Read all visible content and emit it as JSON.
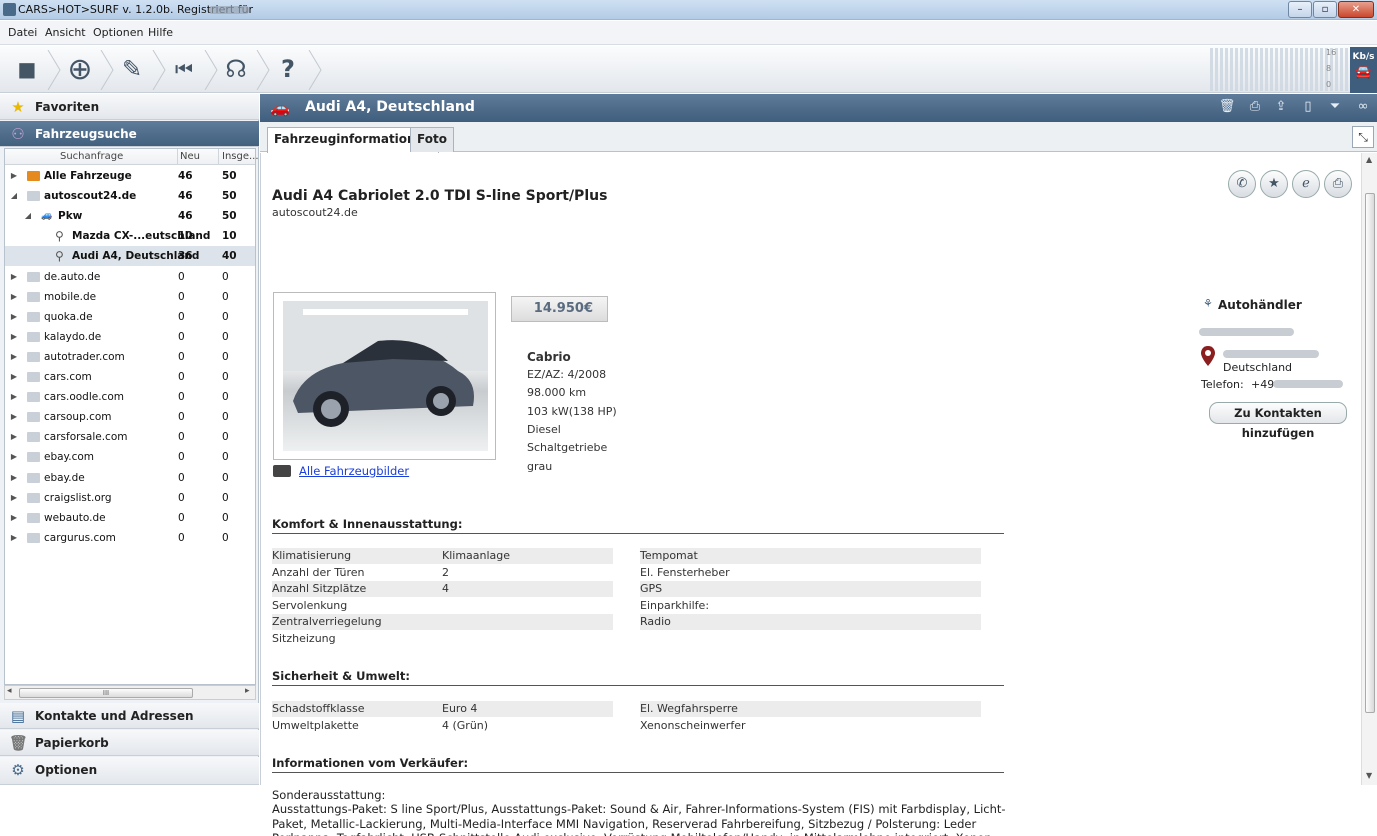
{
  "window": {
    "title": "CARS>HOT>SURF v. 1.2.0b. Registriert für",
    "controls": [
      "–",
      "▫",
      "✕"
    ]
  },
  "menu": [
    "Datei",
    "Ansicht",
    "Optionen",
    "Hilfe"
  ],
  "toolbar": {
    "buttons": [
      {
        "name": "stop-icon",
        "glyph": "■"
      },
      {
        "name": "add-icon",
        "glyph": "⊕"
      },
      {
        "name": "edit-icon",
        "glyph": "✎"
      },
      {
        "name": "back-icon",
        "glyph": "⏮"
      },
      {
        "name": "headset-icon",
        "glyph": "☊"
      },
      {
        "name": "help-icon",
        "glyph": "?"
      }
    ],
    "meter_scale": [
      "16",
      "8",
      "0"
    ],
    "meter_unit": "Kb/s"
  },
  "sidebar": {
    "favorites": "Favoriten",
    "search": "Fahrzeugsuche",
    "contacts": "Kontakte und Adressen",
    "trash": "Papierkorb",
    "options": "Optionen",
    "columns": [
      "Suchanfrage",
      "Neu",
      "Insge..."
    ],
    "tree": [
      {
        "label": "Alle Fahrzeuge",
        "neu": "46",
        "ges": "50",
        "indent": 0,
        "bold": true,
        "arrow": "▶",
        "icon": "folder-orange"
      },
      {
        "label": "autoscout24.de",
        "neu": "46",
        "ges": "50",
        "indent": 0,
        "bold": true,
        "arrow": "◢",
        "icon": "folder"
      },
      {
        "label": "Pkw",
        "neu": "46",
        "ges": "50",
        "indent": 1,
        "bold": true,
        "arrow": "◢",
        "icon": "car"
      },
      {
        "label": "Mazda CX-...eutschland",
        "neu": "10",
        "ges": "10",
        "indent": 2,
        "bold": true,
        "arrow": "",
        "icon": "search"
      },
      {
        "label": "Audi A4, Deutschland",
        "neu": "36",
        "ges": "40",
        "indent": 2,
        "bold": true,
        "arrow": "",
        "icon": "search",
        "selected": true
      },
      {
        "label": "de.auto.de",
        "neu": "0",
        "ges": "0",
        "indent": 0,
        "arrow": "▶",
        "icon": "folder"
      },
      {
        "label": "mobile.de",
        "neu": "0",
        "ges": "0",
        "indent": 0,
        "arrow": "▶",
        "icon": "folder"
      },
      {
        "label": "quoka.de",
        "neu": "0",
        "ges": "0",
        "indent": 0,
        "arrow": "▶",
        "icon": "folder"
      },
      {
        "label": "kalaydo.de",
        "neu": "0",
        "ges": "0",
        "indent": 0,
        "arrow": "▶",
        "icon": "folder"
      },
      {
        "label": "autotrader.com",
        "neu": "0",
        "ges": "0",
        "indent": 0,
        "arrow": "▶",
        "icon": "folder"
      },
      {
        "label": "cars.com",
        "neu": "0",
        "ges": "0",
        "indent": 0,
        "arrow": "▶",
        "icon": "folder"
      },
      {
        "label": "cars.oodle.com",
        "neu": "0",
        "ges": "0",
        "indent": 0,
        "arrow": "▶",
        "icon": "folder"
      },
      {
        "label": "carsoup.com",
        "neu": "0",
        "ges": "0",
        "indent": 0,
        "arrow": "▶",
        "icon": "folder"
      },
      {
        "label": "carsforsale.com",
        "neu": "0",
        "ges": "0",
        "indent": 0,
        "arrow": "▶",
        "icon": "folder"
      },
      {
        "label": "ebay.com",
        "neu": "0",
        "ges": "0",
        "indent": 0,
        "arrow": "▶",
        "icon": "folder"
      },
      {
        "label": "ebay.de",
        "neu": "0",
        "ges": "0",
        "indent": 0,
        "arrow": "▶",
        "icon": "folder"
      },
      {
        "label": "craigslist.org",
        "neu": "0",
        "ges": "0",
        "indent": 0,
        "arrow": "▶",
        "icon": "folder"
      },
      {
        "label": "webauto.de",
        "neu": "0",
        "ges": "0",
        "indent": 0,
        "arrow": "▶",
        "icon": "folder"
      },
      {
        "label": "cargurus.com",
        "neu": "0",
        "ges": "0",
        "indent": 0,
        "arrow": "▶",
        "icon": "folder"
      }
    ],
    "scroll_thumb_label": "III",
    "scroll_left": "◂",
    "scroll_right": "▸"
  },
  "main": {
    "header_title": "Audi A4, Deutschland",
    "header_actions": [
      "trash-icon",
      "print-icon",
      "export-icon",
      "phone-icon",
      "filter-icon",
      "binoculars-icon"
    ],
    "tabs": [
      "Fahrzeuginformationen",
      "Foto"
    ],
    "listing": {
      "title": "Audi A4 Cabriolet 2.0 TDI S-line Sport/Plus",
      "source": "autoscout24.de",
      "price": "14.950€",
      "photos_link": "Alle Fahrzeugbilder",
      "specs": [
        "Cabrio",
        "EZ/AZ: 4/2008",
        "98.000 km",
        "103 kW(138 HP)",
        "Diesel",
        "Schaltgetriebe",
        "grau"
      ]
    },
    "dealer": {
      "label": "Autohändler",
      "country": "Deutschland",
      "phone_label": "Telefon:",
      "phone_prefix": "+49",
      "add_button": "Zu Kontakten hinzufügen"
    },
    "sections": {
      "komfort": {
        "title": "Komfort & Innenausstattung:",
        "rows": [
          {
            "k": "Klimatisierung",
            "v": "Klimaanlage",
            "r": "Tempomat"
          },
          {
            "k": "Anzahl der Türen",
            "v": "2",
            "r": "El. Fensterheber"
          },
          {
            "k": "Anzahl Sitzplätze",
            "v": "4",
            "r": "GPS"
          },
          {
            "k": "Servolenkung",
            "v": "",
            "r": "Einparkhilfe:"
          },
          {
            "k": "Zentralverriegelung",
            "v": "",
            "r": "Radio"
          },
          {
            "k": "Sitzheizung",
            "v": "",
            "r": ""
          }
        ]
      },
      "sicherheit": {
        "title": "Sicherheit & Umwelt:",
        "rows": [
          {
            "k": "Schadstoffklasse",
            "v": "Euro 4",
            "r": "El. Wegfahrsperre"
          },
          {
            "k": "Umweltplakette",
            "v": "4 (Grün)",
            "r": "Xenonscheinwerfer"
          }
        ]
      },
      "verkaeufer": {
        "title": "Informationen vom Verkäufer:",
        "label": "Sonderausstattung:",
        "text": "Ausstattungs-Paket: S line Sport/Plus, Ausstattungs-Paket: Sound & Air, Fahrer-Informations-System (FIS) mit Farbdisplay, Licht-Paket, Metallic-Lackierung, Multi-Media-Interface MMI Navigation, Reserverad Fahrbereifung, Sitzbezug / Polsterung: Leder Perlnappa, Tagfahrlicht, USB-Schnittstelle Audi exclusive, Vorrüstung Mobiltelefon/Handy, in Mittelarmlehne integriert, Xenon-Scheinwerfer Plus (Abblend- und Fernlicht)"
      }
    },
    "action_icons": [
      "phone-icon",
      "star-icon",
      "browser-icon",
      "print-icon"
    ]
  },
  "colors": {
    "accent": "#4a6a8a",
    "link": "#1a3fd8",
    "header": "#42617f"
  }
}
